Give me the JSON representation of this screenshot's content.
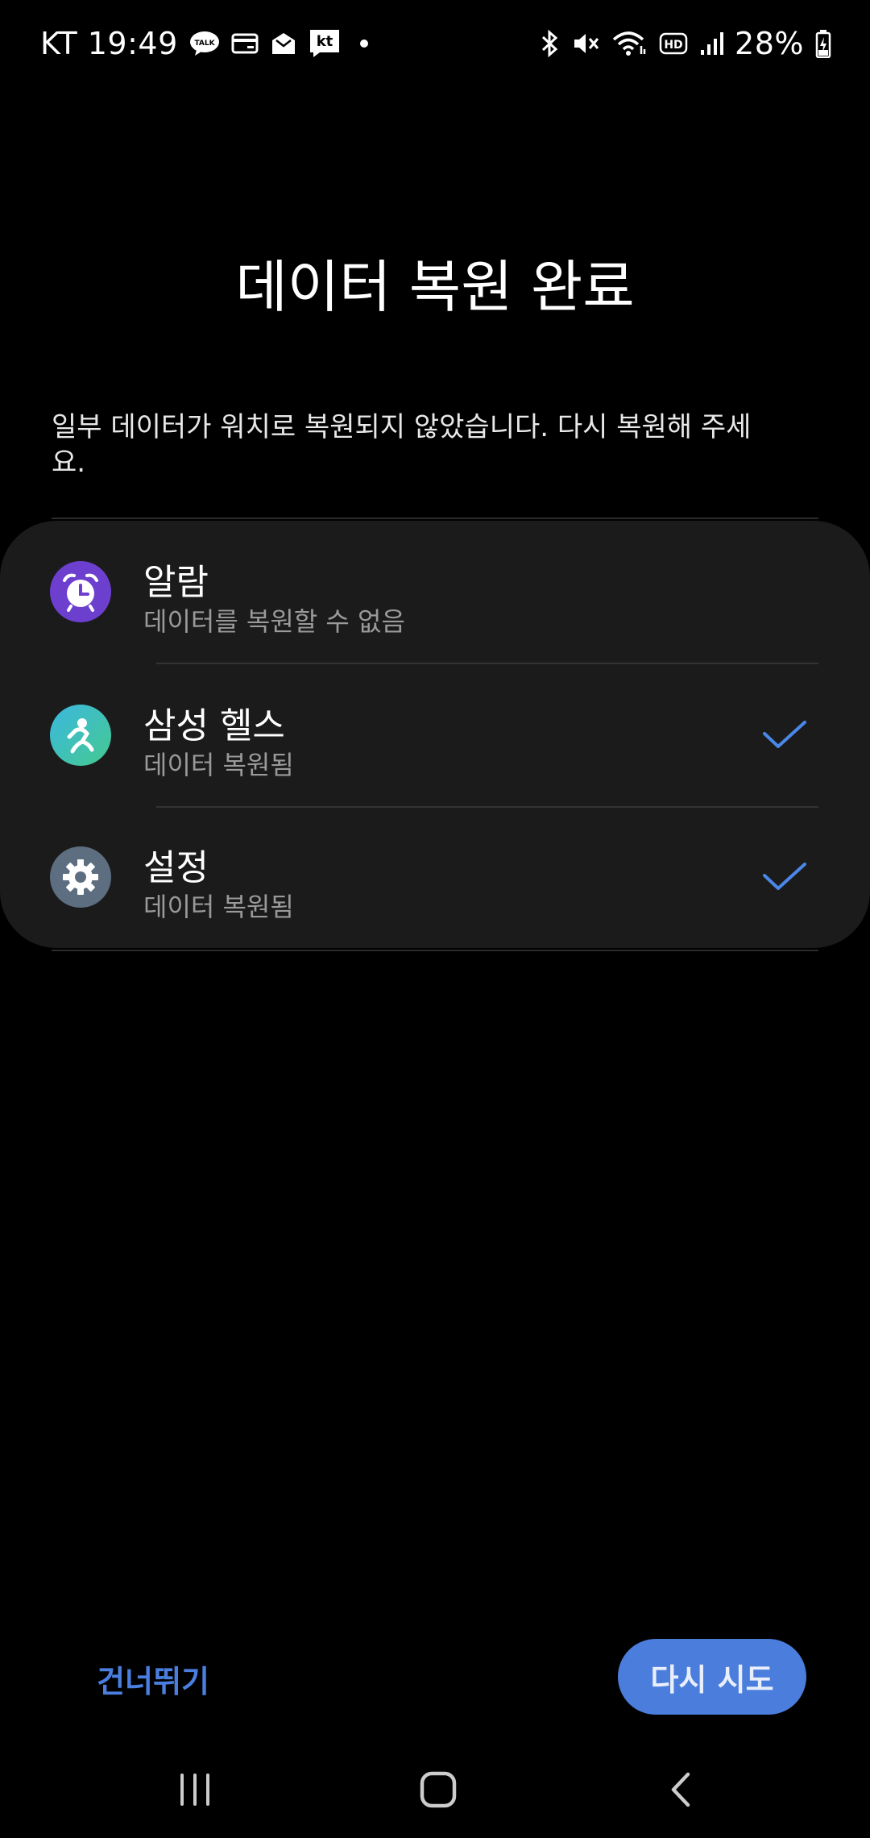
{
  "status_bar": {
    "carrier_time": "KT 19:49",
    "battery": "28%",
    "left_icons": [
      "kakaotalk-icon",
      "wallet-icon",
      "mail-icon",
      "kt-app-icon"
    ],
    "right_icons": [
      "bluetooth-icon",
      "mute-icon",
      "wifi-icon",
      "hd-icon",
      "signal-icon",
      "battery-charging-icon"
    ]
  },
  "page": {
    "title": "데이터 복원 완료",
    "description": "일부 데이터가 워치로 복원되지 않았습니다. 다시 복원해 주세요."
  },
  "apps": [
    {
      "name": "알람",
      "status": "데이터를 복원할 수 없음",
      "checked": false,
      "icon": "alarm-icon",
      "icon_color": "#6d3fcf"
    },
    {
      "name": "삼성 헬스",
      "status": "데이터 복원됨",
      "checked": true,
      "icon": "samsung-health-icon",
      "icon_color": "#3fbf9a"
    },
    {
      "name": "설정",
      "status": "데이터 복원됨",
      "checked": true,
      "icon": "settings-gear-icon",
      "icon_color": "#5d6e80"
    }
  ],
  "buttons": {
    "skip": "건너뛰기",
    "retry": "다시 시도"
  },
  "colors": {
    "accent": "#4b7ddc",
    "check": "#4a88e8",
    "card": "#1b1b1b"
  }
}
